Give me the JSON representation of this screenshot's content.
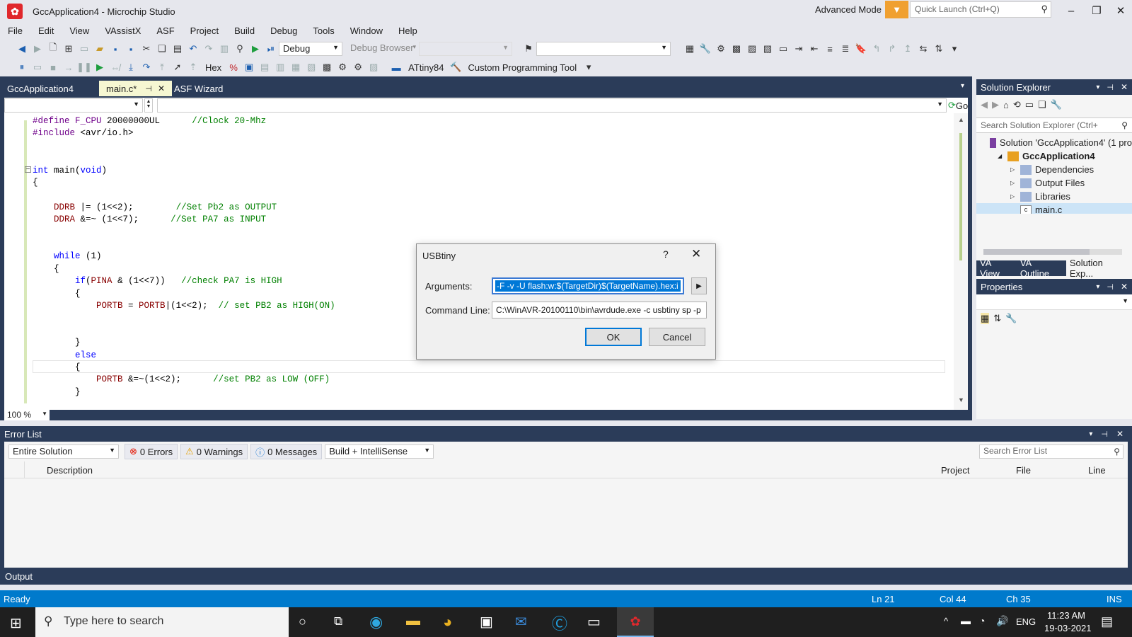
{
  "window": {
    "title": "GccApplication4 - Microchip Studio",
    "mode": "Advanced Mode",
    "quick_launch_placeholder": "Quick Launch (Ctrl+Q)"
  },
  "menu": [
    "File",
    "Edit",
    "View",
    "VAssistX",
    "ASF",
    "Project",
    "Build",
    "Debug",
    "Tools",
    "Window",
    "Help"
  ],
  "toolbar": {
    "config": "Debug",
    "debug_browser": "Debug Browser",
    "hex": "Hex",
    "device": "ATtiny84",
    "tool": "Custom Programming Tool"
  },
  "tabs": [
    {
      "label": "GccApplication4"
    },
    {
      "label": "main.c*"
    },
    {
      "label": "ASF Wizard"
    }
  ],
  "nav": {
    "go": "Go"
  },
  "code": [
    {
      "row": 0,
      "parts": [
        [
          "df",
          "#define "
        ],
        [
          "df",
          "F_CPU "
        ],
        [
          "",
          "20000000UL      "
        ],
        [
          "cm",
          "//Clock 20-Mhz"
        ]
      ]
    },
    {
      "row": 1,
      "parts": [
        [
          "df",
          "#include "
        ],
        [
          "",
          "<avr/io.h>"
        ]
      ]
    },
    {
      "row": 4,
      "parts": [
        [
          "kw",
          "int "
        ],
        [
          "",
          "main("
        ],
        [
          "kw",
          "void"
        ],
        [
          "",
          ")"
        ]
      ]
    },
    {
      "row": 5,
      "parts": [
        [
          "",
          "{"
        ]
      ]
    },
    {
      "row": 7,
      "parts": [
        [
          "",
          "    "
        ],
        [
          "id",
          "DDRB "
        ],
        [
          "",
          "|= (1<<2);        "
        ],
        [
          "cm",
          "//Set Pb2 as OUTPUT"
        ]
      ]
    },
    {
      "row": 8,
      "parts": [
        [
          "",
          "    "
        ],
        [
          "id",
          "DDRA "
        ],
        [
          "",
          "&=~ (1<<7);      "
        ],
        [
          "cm",
          "//Set PA7 as INPUT"
        ]
      ]
    },
    {
      "row": 11,
      "parts": [
        [
          "",
          "    "
        ],
        [
          "kw",
          "while "
        ],
        [
          "",
          "(1)"
        ]
      ]
    },
    {
      "row": 12,
      "parts": [
        [
          "",
          "    {"
        ]
      ]
    },
    {
      "row": 13,
      "parts": [
        [
          "",
          "        "
        ],
        [
          "kw",
          "if"
        ],
        [
          "",
          "("
        ],
        [
          "id",
          "PINA "
        ],
        [
          "",
          "& (1<<7))   "
        ],
        [
          "cm",
          "//check PA7 is HIGH"
        ]
      ]
    },
    {
      "row": 14,
      "parts": [
        [
          "",
          "        {"
        ]
      ]
    },
    {
      "row": 15,
      "parts": [
        [
          "",
          "            "
        ],
        [
          "id",
          "PORTB "
        ],
        [
          "",
          "= "
        ],
        [
          "id",
          "PORTB"
        ],
        [
          "",
          "|(1<<2);  "
        ],
        [
          "cm",
          "// set PB2 as HIGH(ON)"
        ]
      ]
    },
    {
      "row": 18,
      "parts": [
        [
          "",
          "        }"
        ]
      ]
    },
    {
      "row": 19,
      "parts": [
        [
          "",
          "        "
        ],
        [
          "kw",
          "else"
        ]
      ]
    },
    {
      "row": 20,
      "parts": [
        [
          "",
          "        {"
        ]
      ]
    },
    {
      "row": 21,
      "parts": [
        [
          "",
          "            "
        ],
        [
          "id",
          "PORTB "
        ],
        [
          "",
          "&=~(1<<2);      "
        ],
        [
          "cm",
          "//set PB2 as LOW (OFF)"
        ]
      ]
    },
    {
      "row": 22,
      "parts": [
        [
          "",
          "        }"
        ]
      ]
    }
  ],
  "editor": {
    "zoom": "100 %"
  },
  "solution_explorer": {
    "title": "Solution Explorer",
    "search_placeholder": "Search Solution Explorer (Ctrl+",
    "items": [
      {
        "label": "Solution 'GccApplication4' (1 pro",
        "level": 0,
        "icon": "solution"
      },
      {
        "label": "GccApplication4",
        "level": 1,
        "icon": "project",
        "bold": true
      },
      {
        "label": "Dependencies",
        "level": 2,
        "icon": "folder"
      },
      {
        "label": "Output Files",
        "level": 2,
        "icon": "folder"
      },
      {
        "label": "Libraries",
        "level": 2,
        "icon": "folder"
      },
      {
        "label": "main.c",
        "level": 2,
        "icon": "c-file",
        "selected": true
      }
    ],
    "tabs": [
      "VA View",
      "VA Outline",
      "Solution Exp..."
    ]
  },
  "properties": {
    "title": "Properties"
  },
  "error_list": {
    "title": "Error List",
    "scope": "Entire Solution",
    "errors": "0 Errors",
    "warnings": "0 Warnings",
    "messages": "0 Messages",
    "filter": "Build + IntelliSense",
    "search_placeholder": "Search Error List",
    "columns": [
      "Description",
      "Project",
      "File",
      "Line"
    ]
  },
  "output": {
    "title": "Output"
  },
  "status": {
    "state": "Ready",
    "line": "Ln 21",
    "col": "Col 44",
    "ch": "Ch 35",
    "mode": "INS"
  },
  "taskbar": {
    "search_placeholder": "Type here to search",
    "lang": "ENG",
    "time": "11:23 AM",
    "date": "19-03-2021"
  },
  "dialog": {
    "title": "USBtiny",
    "help": "?",
    "arguments_label": "Arguments:",
    "arguments_value": "-F -v -U flash:w:$(TargetDir)$(TargetName).hex:i",
    "command_label": "Command Line:",
    "command_value": "C:\\WinAVR-20100110\\bin\\avrdude.exe -c usbtiny sp -p",
    "ok": "OK",
    "cancel": "Cancel"
  }
}
